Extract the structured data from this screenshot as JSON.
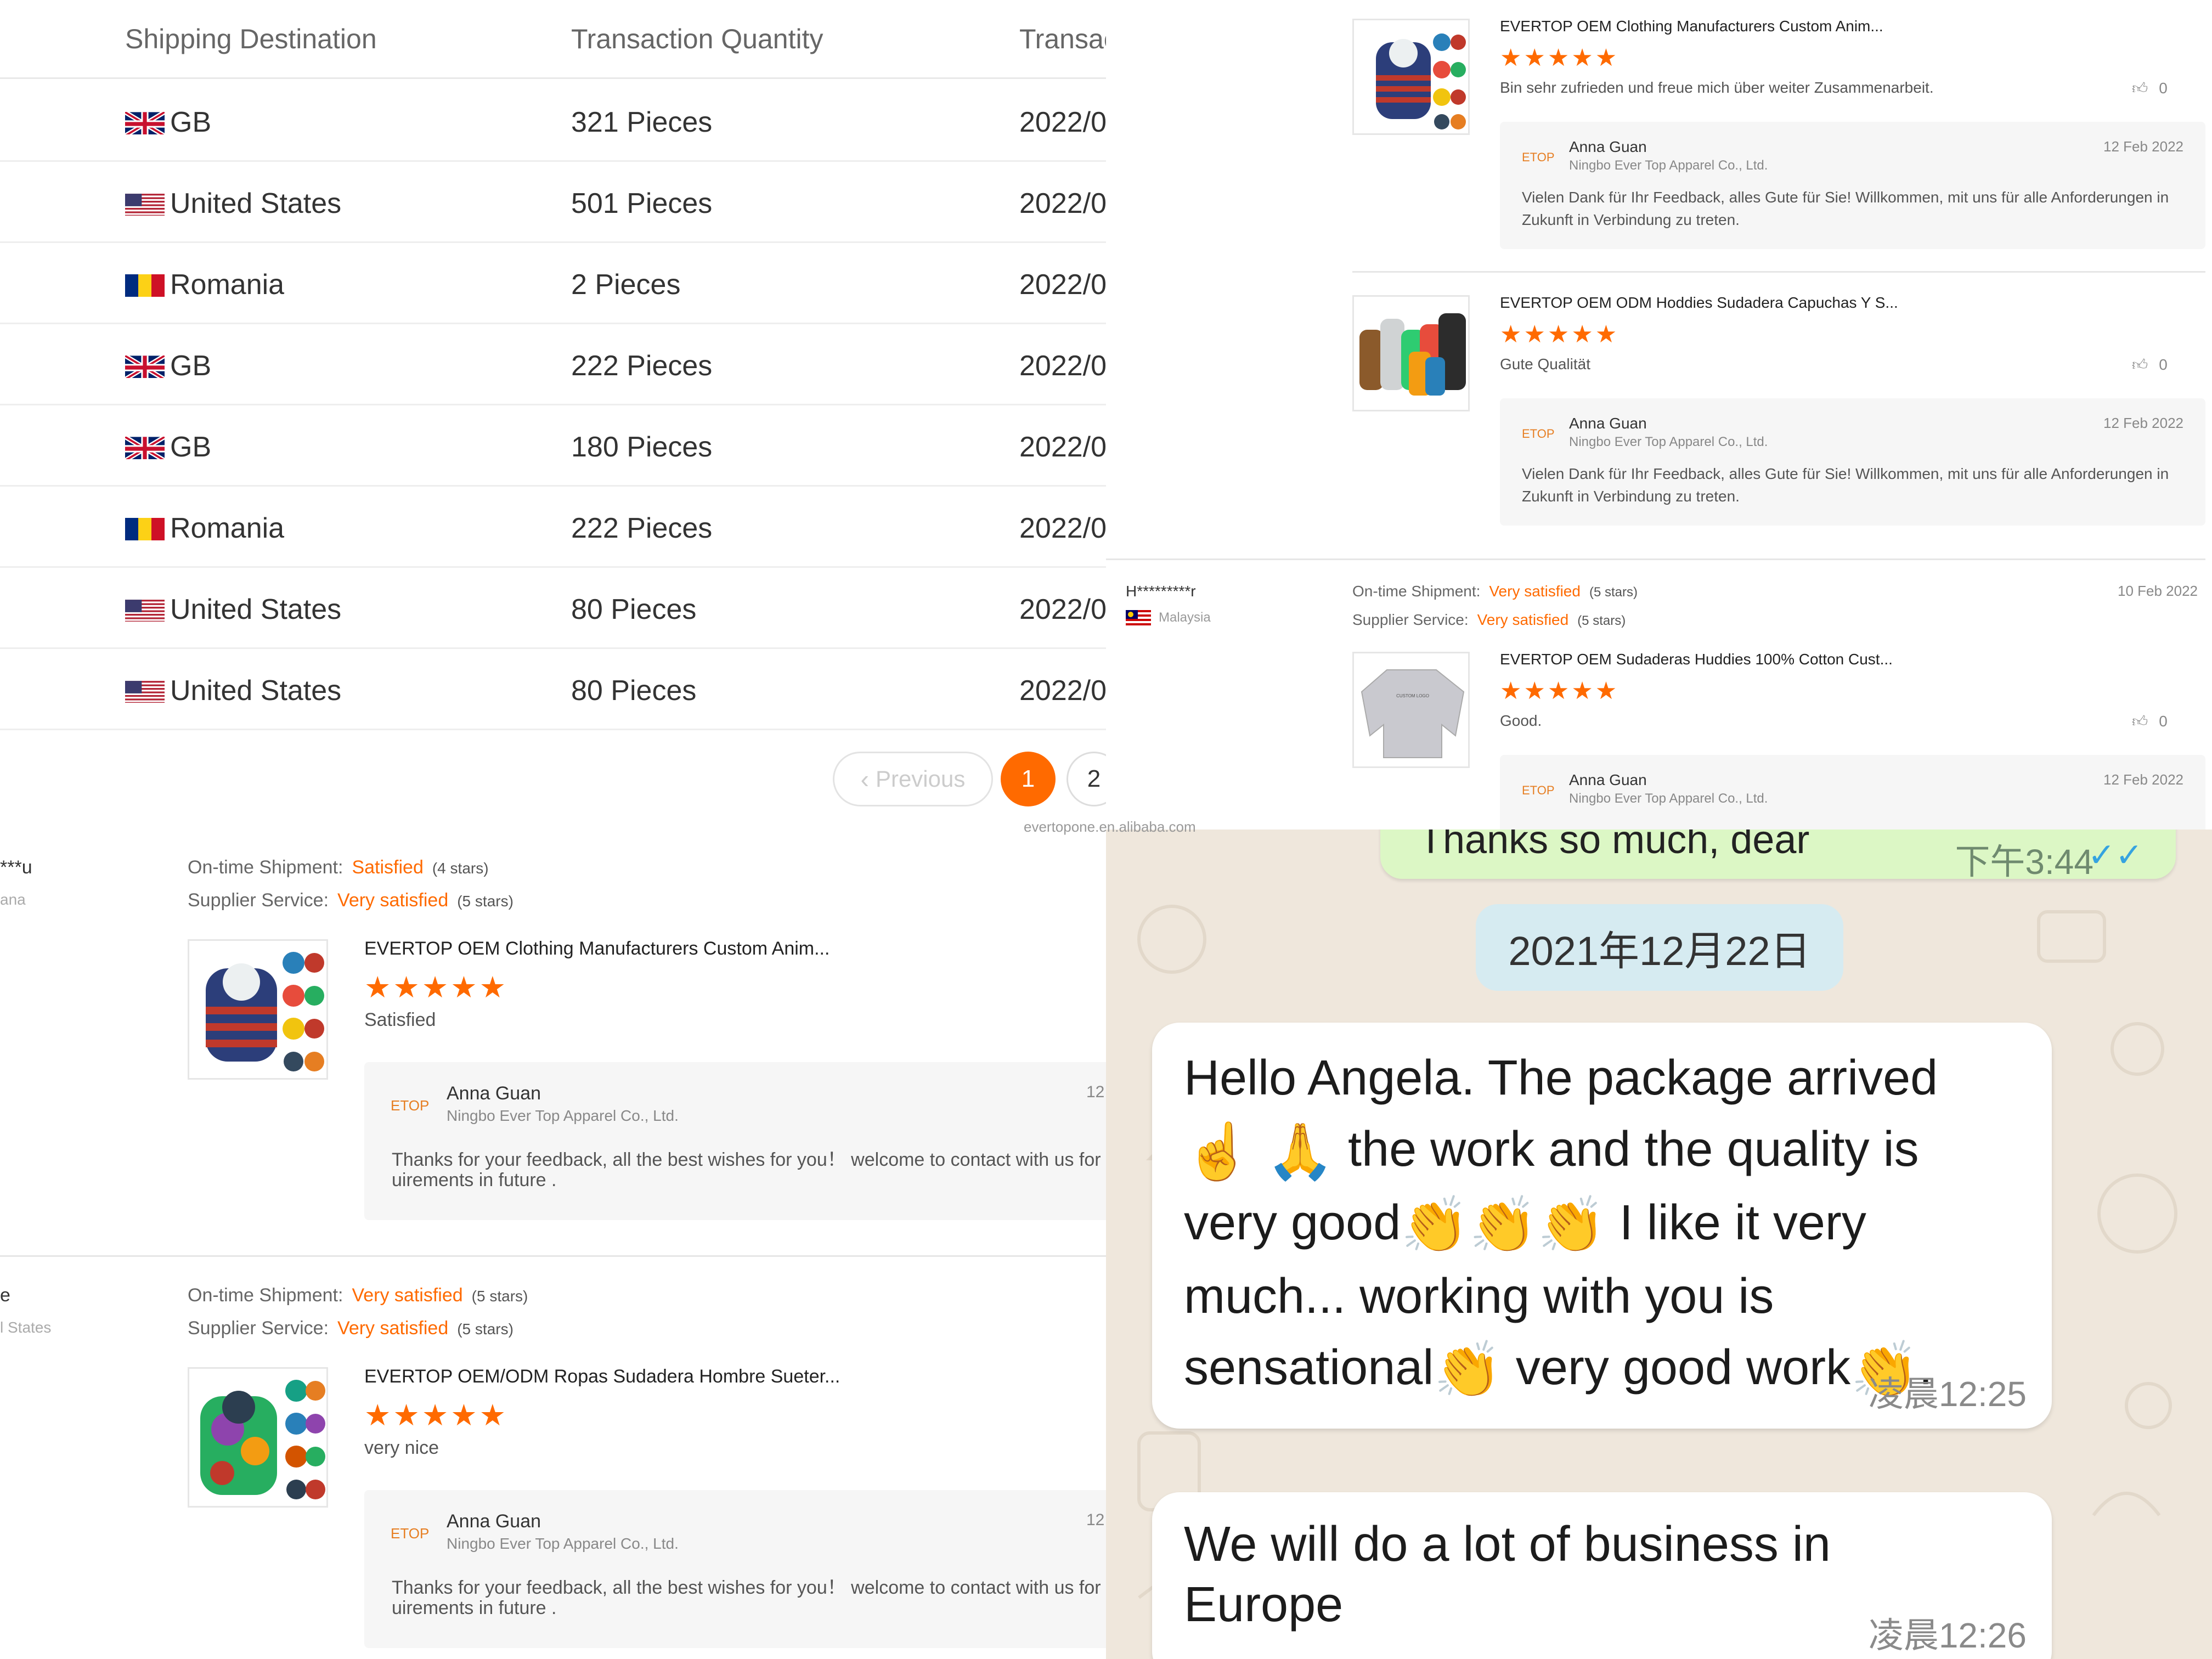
{
  "transactions": {
    "headers": {
      "destination": "Shipping Destination",
      "quantity": "Transaction Quantity",
      "date": "Transac"
    },
    "rows": [
      {
        "flag": "gb",
        "destination": "GB",
        "quantity": "321 Pieces",
        "date": "2022/0"
      },
      {
        "flag": "us",
        "destination": "United States",
        "quantity": "501 Pieces",
        "date": "2022/0"
      },
      {
        "flag": "ro",
        "destination": "Romania",
        "quantity": "2 Pieces",
        "date": "2022/0"
      },
      {
        "flag": "gb",
        "destination": "GB",
        "quantity": "222 Pieces",
        "date": "2022/0"
      },
      {
        "flag": "gb",
        "destination": "GB",
        "quantity": "180 Pieces",
        "date": "2022/0"
      },
      {
        "flag": "ro",
        "destination": "Romania",
        "quantity": "222 Pieces",
        "date": "2022/0"
      },
      {
        "flag": "us",
        "destination": "United States",
        "quantity": "80 Pieces",
        "date": "2022/0"
      },
      {
        "flag": "us",
        "destination": "United States",
        "quantity": "80 Pieces",
        "date": "2022/0"
      }
    ],
    "pager": {
      "previous": "Previous",
      "page1": "1",
      "page2": "2"
    },
    "watermark": "evertopone.en.alibaba.com"
  },
  "reviews_right": {
    "items": [
      {
        "title": "EVERTOP OEM Clothing Manufacturers Custom Anim...",
        "stars": "★★★★★",
        "comment": "Bin sehr zufrieden und freue mich über weiter Zusammenarbeit.",
        "likes": "0",
        "reply_name": "Anna Guan",
        "reply_company": "Ningbo Ever Top Apparel Co., Ltd.",
        "reply_date": "12 Feb 2022",
        "reply_text": "Vielen Dank für Ihr Feedback, alles Gute für Sie! Willkommen, mit uns für alle Anforderungen in Zukunft in Verbindung zu treten."
      },
      {
        "title": "EVERTOP OEM ODM Hoddies Sudadera Capuchas Y S...",
        "stars": "★★★★★",
        "comment": "Gute Qualität",
        "likes": "0",
        "reply_name": "Anna Guan",
        "reply_company": "Ningbo Ever Top Apparel Co., Ltd.",
        "reply_date": "12 Feb 2022",
        "reply_text": "Vielen Dank für Ihr Feedback, alles Gute für Sie! Willkommen, mit uns für alle Anforderungen in Zukunft in Verbindung zu treten."
      },
      {
        "reviewer": "H*********r",
        "country": "Malaysia",
        "shipment_label": "On-time Shipment:",
        "shipment_value": "Very satisfied",
        "shipment_stars": "(5 stars)",
        "service_label": "Supplier Service:",
        "service_value": "Very satisfied",
        "service_stars": "(5 stars)",
        "review_date": "10 Feb 2022",
        "title": "EVERTOP OEM Sudaderas Huddies 100% Cotton Cust...",
        "stars": "★★★★★",
        "comment": "Good.",
        "likes": "0",
        "reply_name": "Anna Guan",
        "reply_company": "Ningbo Ever Top Apparel Co., Ltd.",
        "reply_date": "12 Feb 2022"
      }
    ]
  },
  "reviews_left": {
    "items": [
      {
        "reviewer": "***u",
        "country": "ana",
        "shipment_label": "On-time Shipment:",
        "shipment_value": "Satisfied",
        "shipment_stars": "(4 stars)",
        "service_label": "Supplier Service:",
        "service_value": "Very satisfied",
        "service_stars": "(5 stars)",
        "title": "EVERTOP OEM Clothing Manufacturers Custom Anim...",
        "stars": "★★★★★",
        "comment": "Satisfied",
        "reply_name": "Anna Guan",
        "reply_company": "Ningbo Ever Top Apparel Co., Ltd.",
        "reply_date": "12",
        "reply_line1": "Thanks for your feedback, all the best wishes for you！ welcome to contact with us for",
        "reply_line2": "uirements in future ."
      },
      {
        "reviewer": "e",
        "country": "l States",
        "shipment_label": "On-time Shipment:",
        "shipment_value": "Very satisfied",
        "shipment_stars": "(5 stars)",
        "service_label": "Supplier Service:",
        "service_value": "Very satisfied",
        "service_stars": "(5 stars)",
        "title": "EVERTOP OEM/ODM Ropas Sudadera Hombre Sueter...",
        "stars": "★★★★★",
        "comment": "very nice",
        "reply_name": "Anna Guan",
        "reply_company": "Ningbo Ever Top Apparel Co., Ltd.",
        "reply_date": "12",
        "reply_line1": "Thanks for your feedback, all the best wishes for you！ welcome to contact with us for",
        "reply_line2": "uirements in future ."
      }
    ]
  },
  "chat": {
    "prev_text": "Thanks so much, dear",
    "prev_time": "下午3:44",
    "prev_ticks": "✓✓",
    "date_chip": "2021年12月22日",
    "msg1": {
      "l1": "Hello Angela. The package arrived",
      "l2a": "☝",
      "l2b": "🙏",
      "l2c": " the work and the quality is",
      "l3a": "very good",
      "clap": "👏",
      "l3b": " I like it very",
      "l4": "much... working with you is",
      "l5a": "sensational",
      "l5b": " very good work",
      "l5c": ".",
      "time": "凌晨12:25"
    },
    "msg2": {
      "l1": "We will do a lot of business in",
      "l2": "Europe",
      "time": "凌晨12:26"
    }
  }
}
